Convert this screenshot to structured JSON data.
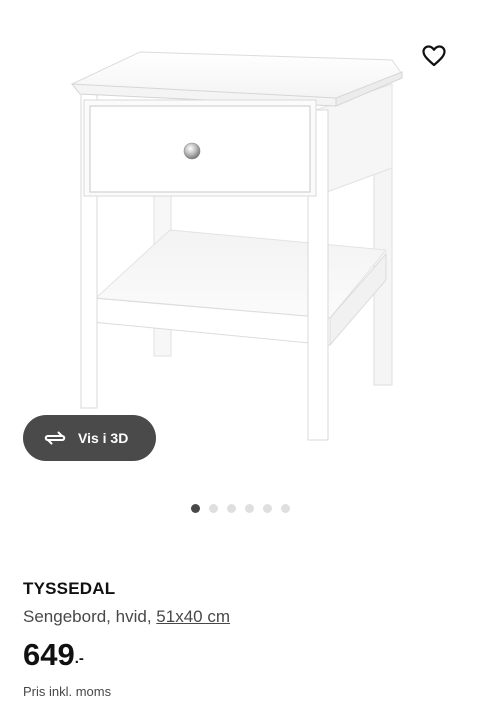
{
  "product": {
    "name": "TYSSEDAL",
    "description_prefix": "Sengebord, hvid,",
    "measurement": "51x40 cm",
    "price": "649",
    "price_suffix": ".-",
    "price_note": "Pris inkl. moms",
    "image_icon": "bedside-table-image"
  },
  "actions": {
    "favorite_icon": "heart-icon",
    "view_3d_label": "Vis i 3D",
    "view_3d_icon": "rotate-3d-icon"
  },
  "carousel": {
    "total": 6,
    "active": 1
  },
  "colors": {
    "button_bg": "#4a4a4a",
    "dot_active": "#484848",
    "dot_inactive": "#dfdfdf"
  }
}
